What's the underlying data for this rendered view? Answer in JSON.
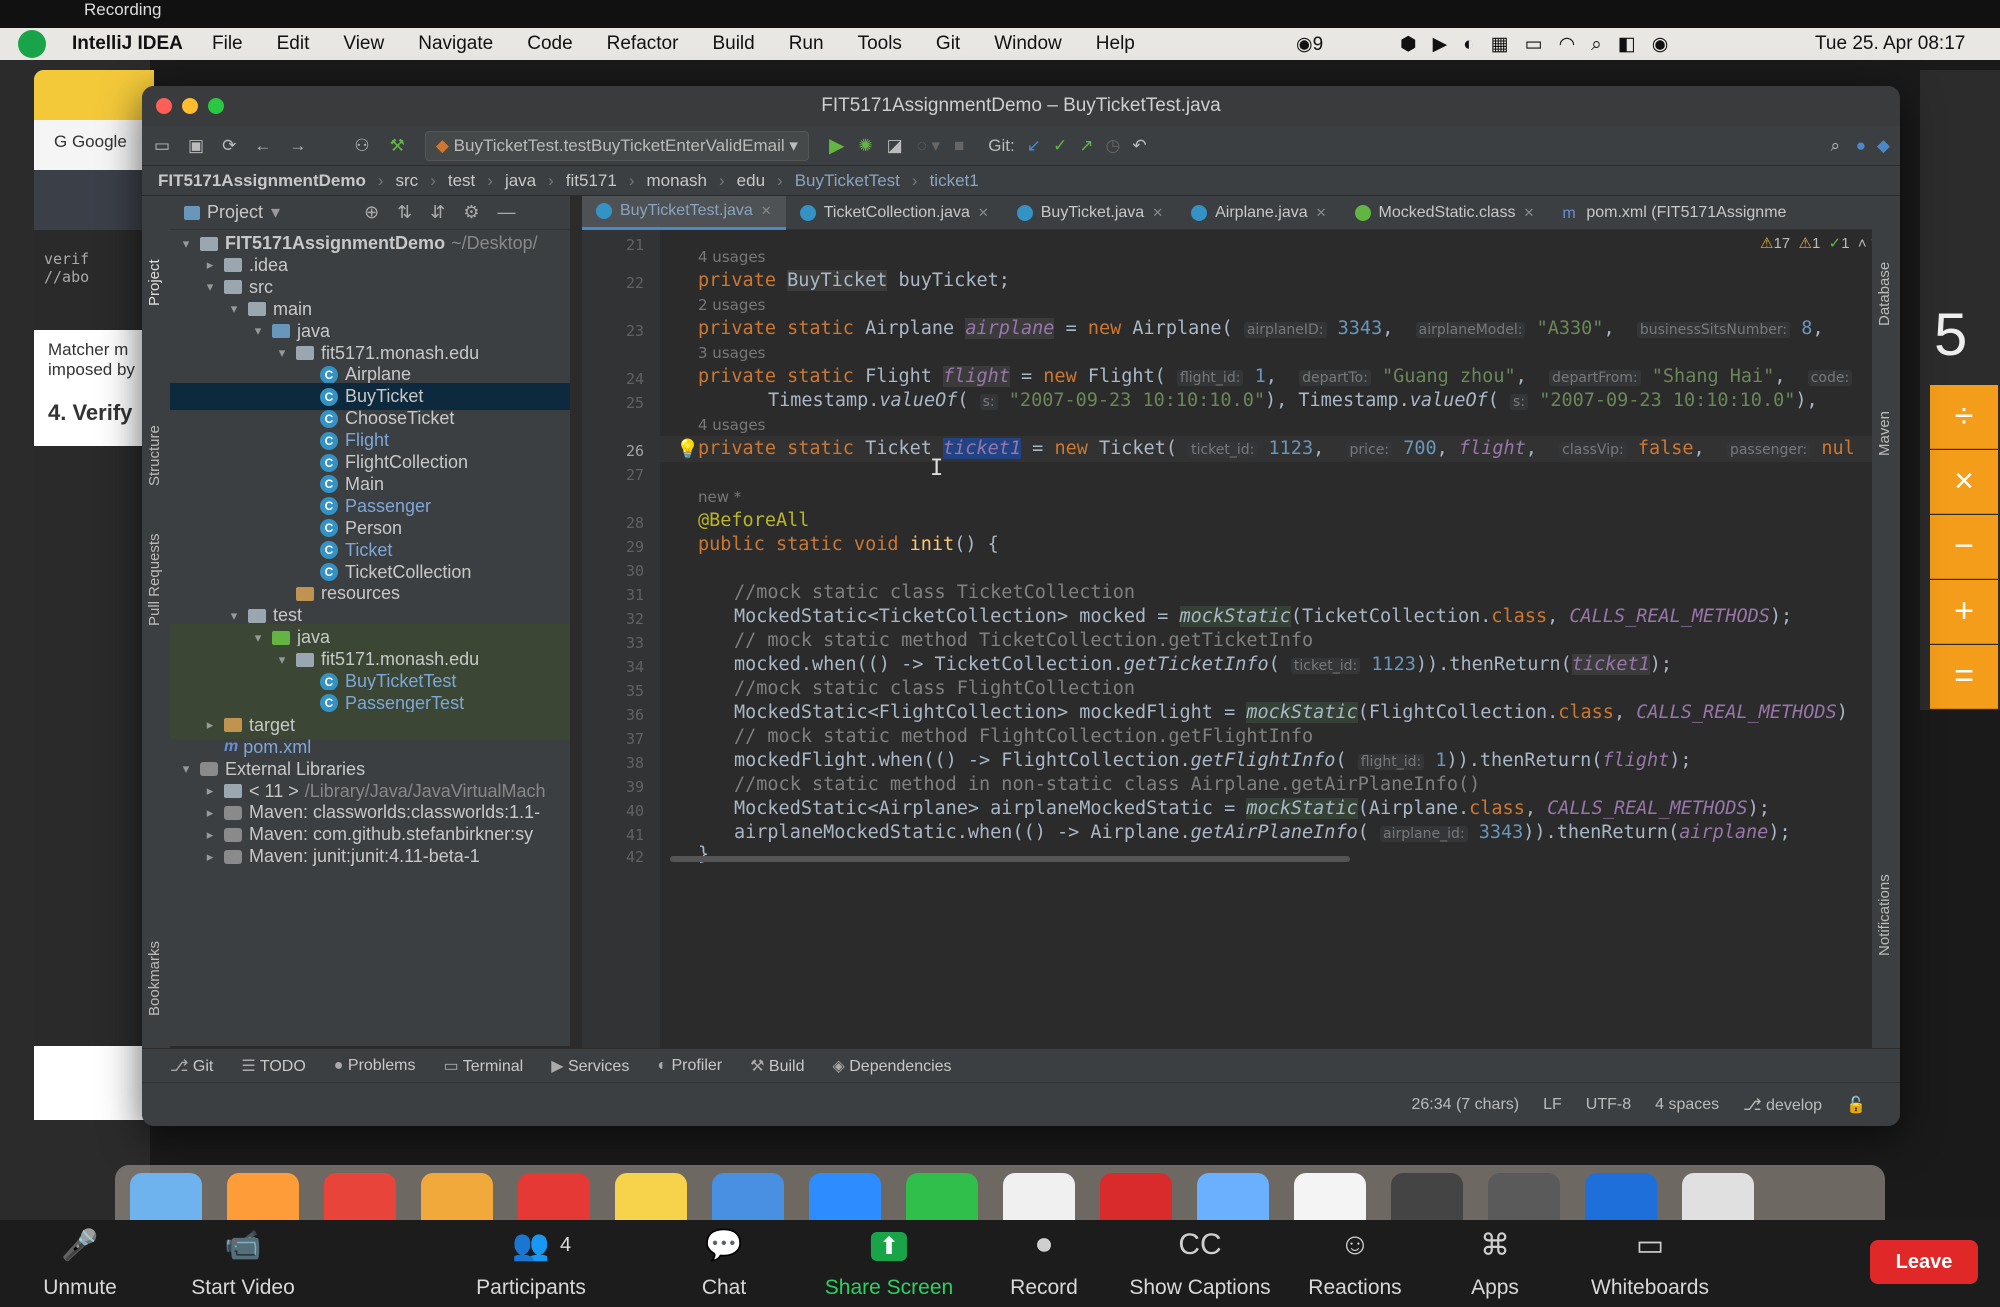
{
  "menubar": {
    "app": "IntelliJ IDEA",
    "recording": "Recording",
    "items": [
      "File",
      "Edit",
      "View",
      "Navigate",
      "Code",
      "Refactor",
      "Build",
      "Run",
      "Tools",
      "Git",
      "Window",
      "Help"
    ],
    "badge_count": "9",
    "datetime": "Tue 25. Apr  08:17"
  },
  "window": {
    "title": "FIT5171AssignmentDemo – BuyTicketTest.java"
  },
  "toolbar": {
    "run_config": "BuyTicketTest.testBuyTicketEnterValidEmail",
    "git_label": "Git:"
  },
  "breadcrumb": [
    "FIT5171AssignmentDemo",
    "src",
    "test",
    "java",
    "fit5171",
    "monash",
    "edu",
    "BuyTicketTest",
    "ticket1"
  ],
  "project": {
    "header": "Project",
    "tree": [
      {
        "label": "FIT5171AssignmentDemo",
        "suffix": "~/Desktop/",
        "icon": "folder",
        "arrow": "down",
        "depth": 0
      },
      {
        "label": ".idea",
        "icon": "folder",
        "arrow": "right",
        "depth": 1
      },
      {
        "label": "src",
        "icon": "folder",
        "arrow": "down",
        "depth": 1
      },
      {
        "label": "main",
        "icon": "folder",
        "arrow": "down",
        "depth": 2
      },
      {
        "label": "java",
        "icon": "folder-blue",
        "arrow": "down",
        "depth": 3
      },
      {
        "label": "fit5171.monash.edu",
        "icon": "folder",
        "arrow": "down",
        "depth": 4
      },
      {
        "label": "Airplane",
        "icon": "class",
        "depth": 5
      },
      {
        "label": "BuyTicket",
        "icon": "class",
        "depth": 5,
        "selected": true
      },
      {
        "label": "ChooseTicket",
        "icon": "class",
        "depth": 5
      },
      {
        "label": "Flight",
        "icon": "class",
        "depth": 5,
        "blue": true
      },
      {
        "label": "FlightCollection",
        "icon": "class",
        "depth": 5
      },
      {
        "label": "Main",
        "icon": "class",
        "depth": 5
      },
      {
        "label": "Passenger",
        "icon": "class",
        "depth": 5,
        "blue": true
      },
      {
        "label": "Person",
        "icon": "class",
        "depth": 5
      },
      {
        "label": "Ticket",
        "icon": "class",
        "depth": 5,
        "blue": true
      },
      {
        "label": "TicketCollection",
        "icon": "class",
        "depth": 5
      },
      {
        "label": "resources",
        "icon": "folder-orange",
        "depth": 4
      },
      {
        "label": "test",
        "icon": "folder",
        "arrow": "down",
        "depth": 2
      },
      {
        "label": "java",
        "icon": "folder-green",
        "arrow": "down",
        "depth": 3,
        "green": true
      },
      {
        "label": "fit5171.monash.edu",
        "icon": "folder",
        "arrow": "down",
        "depth": 4,
        "green": true
      },
      {
        "label": "BuyTicketTest",
        "icon": "class",
        "depth": 5,
        "green": true,
        "blue": true
      },
      {
        "label": "PassengerTest",
        "icon": "class",
        "depth": 5,
        "green": true,
        "blue": true
      },
      {
        "label": "target",
        "icon": "folder-orange",
        "arrow": "right",
        "depth": 1,
        "green": true
      },
      {
        "label": "pom.xml",
        "icon": "m",
        "depth": 1,
        "blue": true
      },
      {
        "label": "External Libraries",
        "icon": "lib",
        "arrow": "down",
        "depth": 0
      },
      {
        "label": "< 11 >",
        "suffix": "/Library/Java/JavaVirtualMach",
        "icon": "folder",
        "arrow": "right",
        "depth": 1
      },
      {
        "label": "Maven: classworlds:classworlds:1.1-",
        "icon": "lib",
        "arrow": "right",
        "depth": 1
      },
      {
        "label": "Maven: com.github.stefanbirkner:sy",
        "icon": "lib",
        "arrow": "right",
        "depth": 1
      },
      {
        "label": "Maven: junit:junit:4.11-beta-1",
        "icon": "lib",
        "arrow": "right",
        "depth": 1
      }
    ]
  },
  "tabs": [
    "BuyTicketTest.java",
    "TicketCollection.java",
    "BuyTicket.java",
    "Airplane.java",
    "MockedStatic.class",
    "pom.xml (FIT5171Assignme"
  ],
  "inspections": {
    "warnings": "17",
    "weak": "1",
    "ok": "1"
  },
  "code": {
    "lines": [
      "21",
      "22",
      "23",
      "24",
      "25",
      "26",
      "27",
      "28",
      "29",
      "30",
      "31",
      "32",
      "33",
      "34",
      "35",
      "36",
      "37",
      "38",
      "39",
      "40",
      "41",
      "42"
    ],
    "usage_4": "4 usages",
    "usage_2": "2 usages",
    "usage_3": "3 usages",
    "new_marker": "new *"
  },
  "bottom_tools": [
    "Git",
    "TODO",
    "Problems",
    "Terminal",
    "Services",
    "Profiler",
    "Build",
    "Dependencies"
  ],
  "status": {
    "position": "26:34 (7 chars)",
    "line_sep": "LF",
    "encoding": "UTF-8",
    "indent": "4 spaces",
    "branch": "develop"
  },
  "zoom": {
    "items": [
      "Unmute",
      "Start Video",
      "Participants",
      "Chat",
      "Share Screen",
      "Record",
      "Show Captions",
      "Reactions",
      "Apps",
      "Whiteboards"
    ],
    "participants_count": "4",
    "leave": "Leave"
  },
  "calculator": {
    "display": "5",
    "ops": [
      "÷",
      "×",
      "−",
      "+",
      "="
    ]
  },
  "background": {
    "browser_tab": "Google",
    "snippets": [
      "verif",
      "//abo",
      "Matcher m",
      "imposed by",
      "4. Verify"
    ]
  },
  "colors": {
    "accent": "#4a88c7",
    "share_green": "#1aa44a",
    "leave_red": "#e02828",
    "calc_orange": "#f49d1a"
  }
}
